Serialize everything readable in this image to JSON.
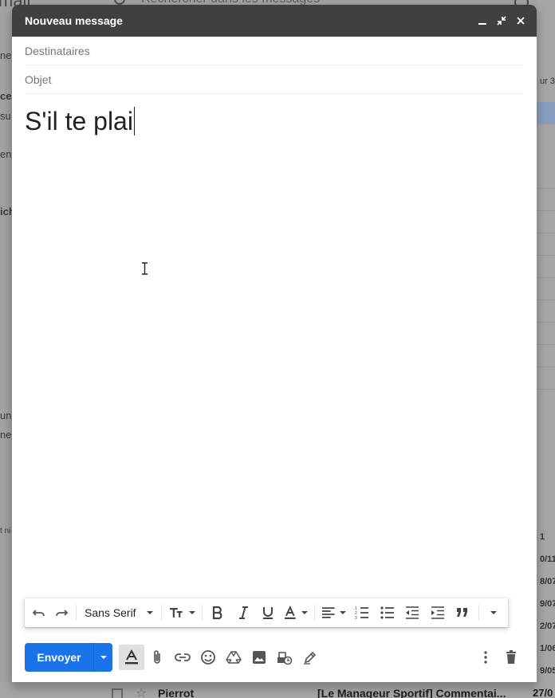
{
  "background": {
    "logo_fragment": "mail",
    "search_placeholder": "Rechercher dans les messages",
    "left_fragments": [
      "ne",
      "ce",
      "su",
      "ent",
      "ich",
      "un",
      "ne",
      "t ni"
    ],
    "right_fragments": [
      "ur 3",
      "1",
      "0/11",
      "8/07",
      "9/07",
      "2/07",
      "1/06",
      "9/05"
    ],
    "bottom_row": {
      "from": "Pierrot",
      "subject": "[Le Manageur Sportif] Commentai...",
      "date": "27/0"
    }
  },
  "compose": {
    "title": "Nouveau message",
    "recipients_placeholder": "Destinataires",
    "subject_placeholder": "Objet",
    "body_text": "S'il te plai",
    "font_name": "Sans Serif",
    "send_label": "Envoyer"
  },
  "icons": {
    "header": [
      "minimize-icon",
      "expand-icon",
      "close-icon"
    ],
    "toolbar": [
      "undo-icon",
      "redo-icon",
      "text-size-icon",
      "bold-icon",
      "italic-icon",
      "underline-icon",
      "text-color-icon",
      "align-icon",
      "numbered-list-icon",
      "bulleted-list-icon",
      "indent-less-icon",
      "indent-more-icon",
      "quote-icon",
      "more-formatting-icon"
    ],
    "actions": [
      "formatting-options-icon",
      "attach-icon",
      "link-icon",
      "emoji-icon",
      "drive-icon",
      "photo-icon",
      "confidential-icon",
      "signature-icon",
      "more-options-icon",
      "discard-icon"
    ]
  },
  "colors": {
    "header_bg": "#404040",
    "send_blue": "#1a73e8",
    "overlay": "#a3a3a3"
  }
}
